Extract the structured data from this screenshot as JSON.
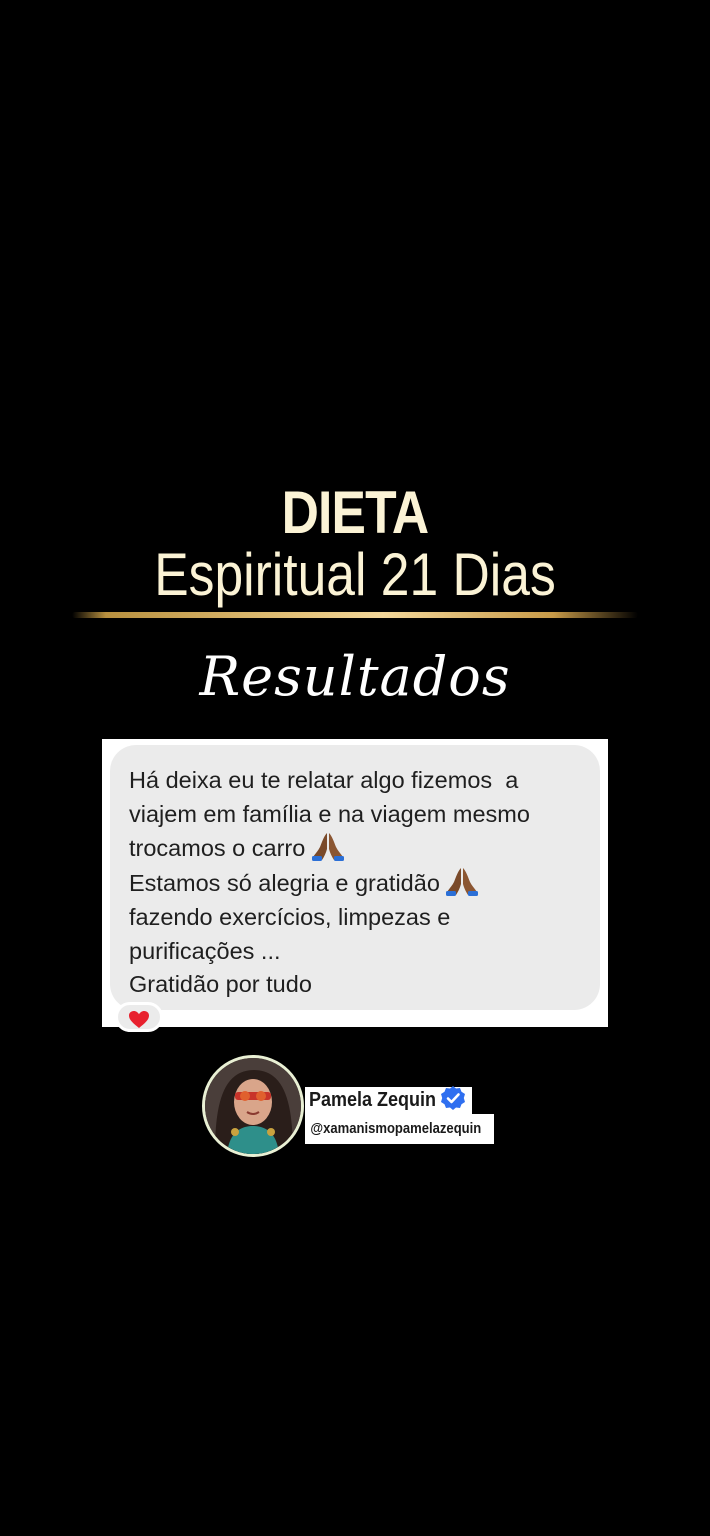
{
  "header": {
    "title": "DIETA",
    "subtitle": "Espiritual 21 Dias",
    "script_heading": "Resultados"
  },
  "message": {
    "lines": [
      "Há deixa eu te relatar algo fizemos  a",
      "viajem em família e na viagem mesmo",
      "trocamos o carro",
      "Estamos só alegria e gratidão",
      "fazendo exercícios, limpezas e",
      "purificações ...",
      "Gratidão por tudo"
    ],
    "emoji": "folded-hands-icon",
    "reaction": "heart-icon"
  },
  "profile": {
    "name": "Pamela Zequin",
    "handle": "@xamanismopamelazequin"
  },
  "colors": {
    "background": "#000000",
    "title": "#FBF3D5",
    "gold_line": "#E4C27A",
    "bubble": "#EBEBEB",
    "verified": "#2F6FF0",
    "heart": "#E8212E"
  }
}
